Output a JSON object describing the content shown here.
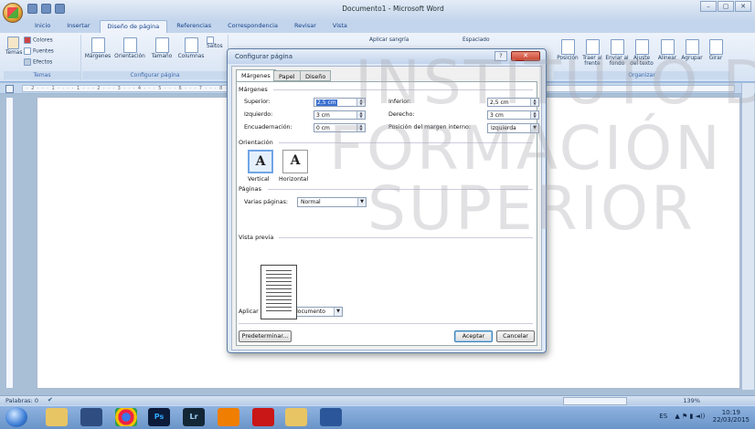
{
  "window": {
    "title": "Documento1 - Microsoft Word",
    "controls": [
      "–",
      "▢",
      "✕"
    ]
  },
  "tabs": [
    "Inicio",
    "Insertar",
    "Diseño de página",
    "Referencias",
    "Correspondencia",
    "Revisar",
    "Vista"
  ],
  "active_tab": "Diseño de página",
  "ribbon": {
    "temas": {
      "temas_label": "Temas",
      "colores": "Colores",
      "fuentes": "Fuentes",
      "efectos": "Efectos",
      "group_label": "Temas"
    },
    "config": {
      "margenes": "Márgenes",
      "orientacion": "Orientación",
      "tamano": "Tamaño",
      "columnas": "Columnas",
      "saltos": "Saltos",
      "group_label": "Configurar página"
    },
    "fondo": {
      "aplicar_sangria": "Aplicar sangría",
      "espaciado": "Espaciado"
    },
    "organizar": {
      "items": [
        "Posición",
        "Traer al frente",
        "Enviar al fondo",
        "Ajuste del texto",
        "Alinear",
        "Agrupar",
        "Girar"
      ],
      "group_label": "Organizar"
    }
  },
  "dialog": {
    "title": "Configurar página",
    "help": "?",
    "close": "✕",
    "tabs": [
      "Márgenes",
      "Papel",
      "Diseño"
    ],
    "active_tab": "Márgenes",
    "margins_section": "Márgenes",
    "superior_label": "Superior:",
    "superior_value": "2,5 cm",
    "inferior_label": "Inferior:",
    "inferior_value": "2,5 cm",
    "izquierdo_label": "Izquierdo:",
    "izquierdo_value": "3 cm",
    "derecho_label": "Derecho:",
    "derecho_value": "3 cm",
    "encuadernacion_label": "Encuadernación:",
    "encuadernacion_value": "0 cm",
    "pos_margen_label": "Posición del margen interno:",
    "pos_margen_value": "Izquierda",
    "orientation_section": "Orientación",
    "vertical_label": "Vertical",
    "horizontal_label": "Horizontal",
    "paginas_section": "Páginas",
    "varias_paginas_label": "Varias páginas:",
    "varias_paginas_value": "Normal",
    "preview_section": "Vista previa",
    "aplicar_label": "Aplicar a:",
    "aplicar_value": "Todo el documento",
    "default_button": "Predeterminar...",
    "ok_button": "Aceptar",
    "cancel_button": "Cancelar"
  },
  "status": {
    "words": "Palabras: 0",
    "zoom": "139%"
  },
  "taskbar": {
    "apps": [
      "folder-icon",
      "media-icon",
      "chrome-icon",
      "photoshop-icon",
      "lightroom-icon",
      "vlc-icon",
      "pdf-icon",
      "shield-icon",
      "word-icon"
    ],
    "ps": "Ps",
    "lr": "Lr",
    "lang": "ES",
    "time": "10:19",
    "date": "22/03/2015"
  },
  "watermark": {
    "line1": "INSTITUTO DE",
    "line2": "FORMACIÓN",
    "line3": "SUPERIOR"
  }
}
